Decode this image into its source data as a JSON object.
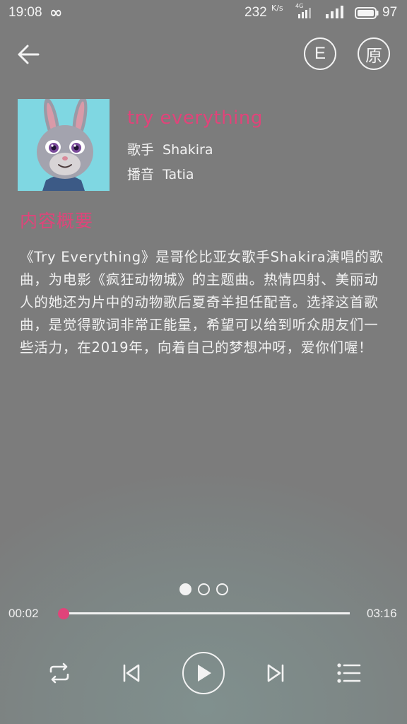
{
  "status_bar": {
    "time": "19:08",
    "infinity": "∞",
    "speed": "232",
    "speed_unit": "K/s",
    "network": "4G",
    "battery": "97"
  },
  "top_bar": {
    "back_icon": "arrow-left-icon",
    "lang_btn": "E",
    "original_btn": "原"
  },
  "song": {
    "title": "try everything",
    "singer_label": "歌手",
    "singer": "Shakira",
    "broadcaster_label": "播音",
    "broadcaster": "Tatia"
  },
  "summary": {
    "title": "内容概要",
    "text": "《Try Everything》是哥伦比亚女歌手Shakira演唱的歌曲，为电影《疯狂动物城》的主题曲。热情四射、美丽动人的她还为片中的动物歌后夏奇羊担任配音。选择这首歌曲，是觉得歌词非常正能量，希望可以给到听众朋友们一些活力，在2019年，向着自己的梦想冲呀，爱你们喔！"
  },
  "player": {
    "current_time": "00:02",
    "total_time": "03:16",
    "progress": 0.01,
    "page_count": 3,
    "active_page": 0,
    "accent_color": "#e0447a"
  }
}
